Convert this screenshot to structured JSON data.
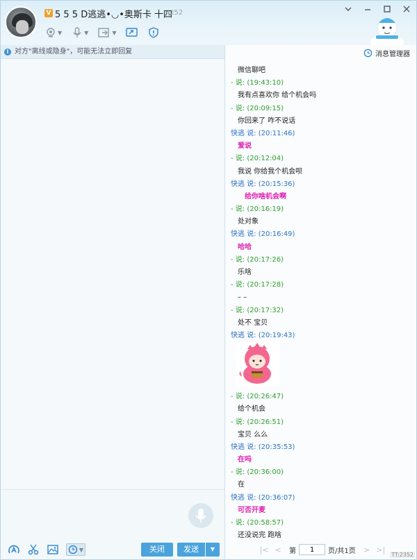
{
  "header": {
    "vip_badge": "V",
    "nickname": "5 5 5 D逃逃•◡•奥斯卡 十四",
    "level": "Lt52"
  },
  "notice": "对方\"离线或隐身\"，可能无法立即回复",
  "right_panel": {
    "message_manager": "消息管理器"
  },
  "history": [
    {
      "kind": "text",
      "text": "微信聊吧"
    },
    {
      "kind": "head",
      "sender": "other",
      "text": "- 说: (19:43:10)"
    },
    {
      "kind": "text",
      "text": "我有点喜欢你 给个机会吗"
    },
    {
      "kind": "head",
      "sender": "other",
      "text": "- 说: (20:09:15)"
    },
    {
      "kind": "text",
      "text": "你回来了 咋不说话"
    },
    {
      "kind": "head",
      "sender": "me",
      "text": "快逃 说: (20:11:46)"
    },
    {
      "kind": "pink",
      "text": "爱说"
    },
    {
      "kind": "head",
      "sender": "other",
      "text": "- 说: (20:12:04)"
    },
    {
      "kind": "text",
      "text": "我说 你给我个机会呗"
    },
    {
      "kind": "head",
      "sender": "me",
      "text": "快逃 说: (20:15:36)"
    },
    {
      "kind": "pink2",
      "text": "给你啥机会啊"
    },
    {
      "kind": "head",
      "sender": "other",
      "text": "- 说: (20:16:19)"
    },
    {
      "kind": "text",
      "text": "处对象"
    },
    {
      "kind": "head",
      "sender": "me",
      "text": "快逃 说: (20:16:49)"
    },
    {
      "kind": "pink",
      "text": "哈哈"
    },
    {
      "kind": "head",
      "sender": "other",
      "text": "- 说: (20:17:26)"
    },
    {
      "kind": "text",
      "text": "乐啥"
    },
    {
      "kind": "head",
      "sender": "other",
      "text": "- 说: (20:17:28)"
    },
    {
      "kind": "text",
      "text": "– –"
    },
    {
      "kind": "head",
      "sender": "other",
      "text": "- 说: (20:17:32)"
    },
    {
      "kind": "text",
      "text": "处不 宝贝"
    },
    {
      "kind": "head",
      "sender": "me",
      "text": "快逃 说: (20:19:43)"
    },
    {
      "kind": "sticker",
      "text": ""
    },
    {
      "kind": "head",
      "sender": "other",
      "text": "- 说: (20:26:47)"
    },
    {
      "kind": "text",
      "text": "给个机会"
    },
    {
      "kind": "head",
      "sender": "other",
      "text": "- 说: (20:26:51)"
    },
    {
      "kind": "text",
      "text": "宝贝 么么"
    },
    {
      "kind": "head",
      "sender": "me",
      "text": "快逃 说: (20:35:53)"
    },
    {
      "kind": "pink",
      "text": "在吗"
    },
    {
      "kind": "head",
      "sender": "other",
      "text": "- 说: (20:36:00)"
    },
    {
      "kind": "text",
      "text": "在"
    },
    {
      "kind": "head",
      "sender": "me",
      "text": "快逃 说: (20:36:07)"
    },
    {
      "kind": "pink",
      "text": "可否开麦"
    },
    {
      "kind": "head",
      "sender": "other",
      "text": "- 说: (20:58:57)"
    },
    {
      "kind": "text",
      "text": "还没说完 跑啥"
    }
  ],
  "buttons": {
    "close": "关闭",
    "send": "发送",
    "send_arrow": "▼"
  },
  "pager": {
    "prefix": "第",
    "page_value": "1",
    "suffix": "页/共1页"
  },
  "watermark": "TT:2352",
  "colors": {
    "accent_blue": "#4aa3dc",
    "other_sender": "#2f9e2f",
    "me_sender": "#2a72c4",
    "pink_text": "#e01fb0"
  }
}
